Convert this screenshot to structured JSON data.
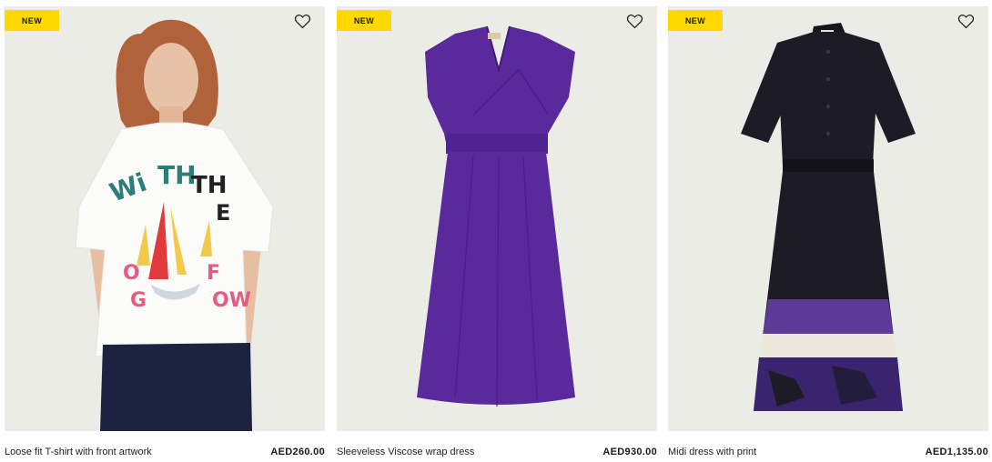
{
  "products": [
    {
      "badge": "NEW",
      "name": "Loose fit T-shirt with front artwork",
      "price": "AED260.00",
      "wishlist_icon": "heart-outline-icon"
    },
    {
      "badge": "NEW",
      "name": "Sleeveless Viscose wrap dress",
      "price": "AED930.00",
      "wishlist_icon": "heart-outline-icon"
    },
    {
      "badge": "NEW",
      "name": "Midi dress with print",
      "price": "AED1,135.00",
      "wishlist_icon": "heart-outline-icon"
    }
  ],
  "colors": {
    "badge_bg": "#ffd800",
    "image_bg": "#ecece6",
    "dress_purple": "#5a2a9c",
    "dress_black": "#1c1b26"
  }
}
